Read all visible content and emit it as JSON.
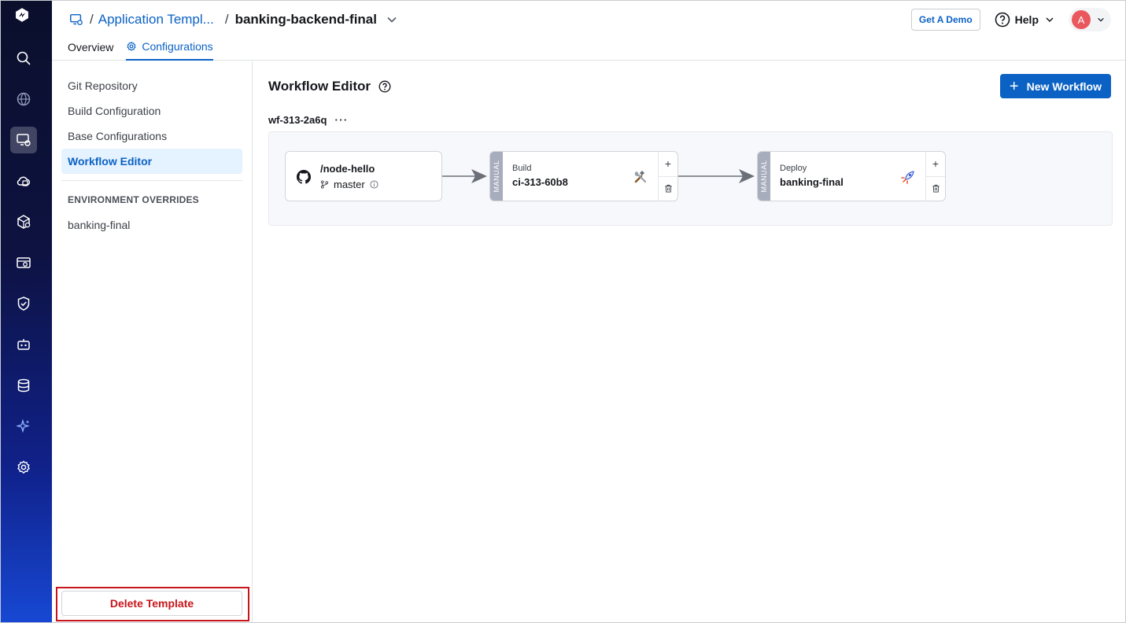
{
  "header": {
    "breadcrumb_sep": "/",
    "breadcrumb_parent": "Application Templ...",
    "breadcrumb_current": "banking-backend-final",
    "get_demo_label": "Get A Demo",
    "help_label": "Help",
    "avatar_initial": "A"
  },
  "tabs": [
    {
      "label": "Overview",
      "active": false
    },
    {
      "label": "Configurations",
      "active": true
    }
  ],
  "rail": {
    "icons": [
      "logo-icon",
      "search-icon",
      "globe-icon",
      "app-templates-icon",
      "cloud-apps-icon",
      "helm-apps-icon",
      "resource-browser-icon",
      "security-icon",
      "bot-icon",
      "database-icon",
      "ai-sparkle-icon",
      "settings-icon"
    ],
    "active": "app-templates-icon"
  },
  "config_nav": {
    "items": [
      {
        "label": "Git Repository",
        "active": false
      },
      {
        "label": "Build Configuration",
        "active": false
      },
      {
        "label": "Base Configurations",
        "active": false
      },
      {
        "label": "Workflow Editor",
        "active": true
      }
    ],
    "env_overrides_heading": "ENVIRONMENT OVERRIDES",
    "environments": [
      "banking-final"
    ],
    "delete_label": "Delete Template"
  },
  "main": {
    "title": "Workflow Editor",
    "new_workflow_label": "New Workflow",
    "workflow_id": "wf-313-2a6q",
    "workflow_menu": "···"
  },
  "workflow": {
    "source": {
      "repo": "/node-hello",
      "branch": "master"
    },
    "build": {
      "trigger": "MANUAL",
      "label": "Build",
      "name": "ci-313-60b8"
    },
    "deploy": {
      "trigger": "MANUAL",
      "label": "Deploy",
      "name": "banking-final"
    },
    "add_symbol": "+"
  },
  "colors": {
    "accent": "#0b62c4",
    "danger": "#c8141a",
    "manual_tag": "#a8adbd",
    "avatar": "#e9585d"
  }
}
